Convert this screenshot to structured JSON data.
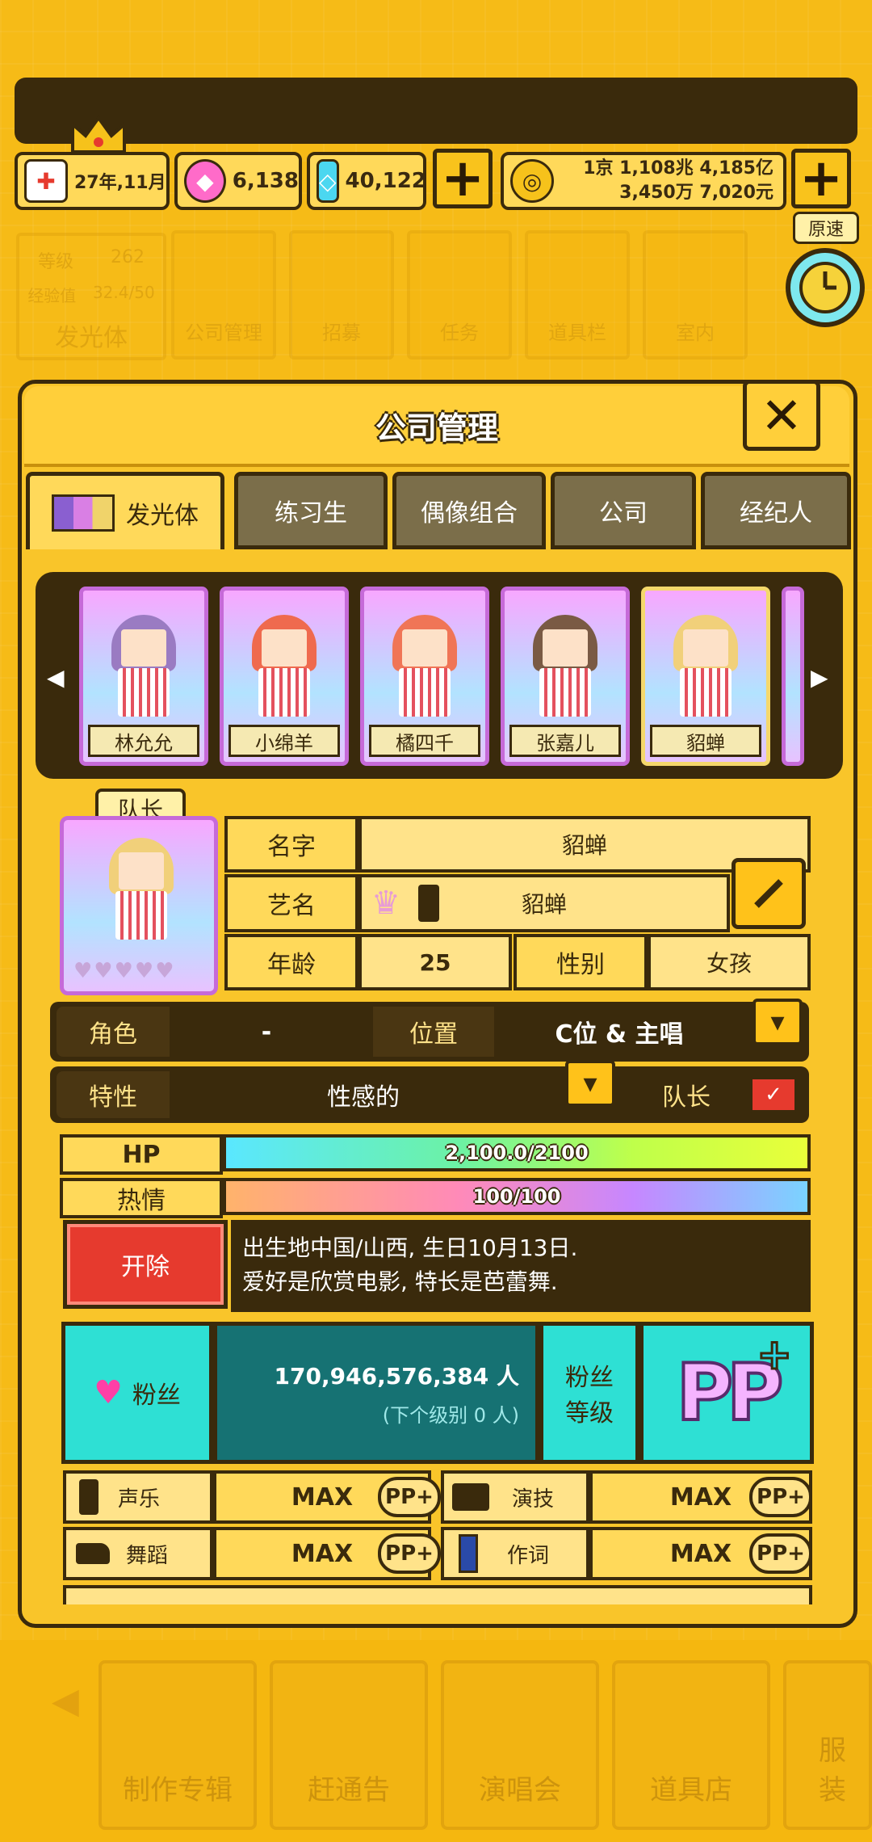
{
  "status": {
    "date": "27年,11月",
    "gems_pink": "6,138",
    "gems_blue": "40,122",
    "money_line1": "1京 1,108兆 4,185亿",
    "money_line2": "3,450万 7,020元",
    "speed_label": "原速"
  },
  "background_menu": {
    "level_label": "等级",
    "level_value": "262",
    "exp_label": "经验值",
    "exp_value": "32.4/50",
    "glow_label": "发光体",
    "tiles": [
      "公司管理",
      "招募",
      "任务",
      "道具栏",
      "室内"
    ]
  },
  "dialog": {
    "title": "公司管理",
    "tabs": [
      "发光体",
      "练习生",
      "偶像组合",
      "公司",
      "经纪人"
    ]
  },
  "roster": [
    {
      "name": "林允允",
      "hair": "#9a7bc2"
    },
    {
      "name": "小绵羊",
      "hair": "#ef6a4e"
    },
    {
      "name": "橘四千",
      "hair": "#f07556"
    },
    {
      "name": "张嘉儿",
      "hair": "#7a5a44"
    },
    {
      "name": "貂蝉",
      "hair": "#f1d07a"
    }
  ],
  "profile": {
    "leader_tag": "队长",
    "name_label": "名字",
    "name_value": "貂蝉",
    "stage_label": "艺名",
    "stage_value": "貂蝉",
    "age_label": "年龄",
    "age_value": "25",
    "gender_label": "性别",
    "gender_value": "女孩",
    "role_label": "角色",
    "role_value": "-",
    "position_label": "位置",
    "position_value": "C位 & 主唱",
    "trait_label": "特性",
    "trait_value": "性感的",
    "captain_label": "队长",
    "hp_label": "HP",
    "hp_value": "2,100.0/2100",
    "hp_fraction": 1.0,
    "passion_label": "热情",
    "passion_value": "100/100",
    "passion_fraction": 1.0,
    "fire_button": "开除",
    "bio_line1": "出生地中国/山西, 生日10月13日.",
    "bio_line2": "爱好是欣赏电影, 特长是芭蕾舞.",
    "fans_label": "粉丝",
    "fans_value": "170,946,576,384 人",
    "fans_next": "(下个级别 0 人)",
    "fan_level_label": "粉丝\n等级",
    "fan_level_badge": "PP"
  },
  "skills": [
    {
      "name": "声乐",
      "value": "MAX",
      "badge": "PP+"
    },
    {
      "name": "演技",
      "value": "MAX",
      "badge": "PP+"
    },
    {
      "name": "舞蹈",
      "value": "MAX",
      "badge": "PP+"
    },
    {
      "name": "作词",
      "value": "MAX",
      "badge": "PP+"
    }
  ],
  "bottom_nav": [
    "制作专辑",
    "赶通告",
    "演唱会",
    "道具店",
    "服装"
  ],
  "colors": {
    "accent": "#f9c52a",
    "dark": "#3a2a0c",
    "teal": "#2ee0d4",
    "fire": "#e63a2e"
  }
}
